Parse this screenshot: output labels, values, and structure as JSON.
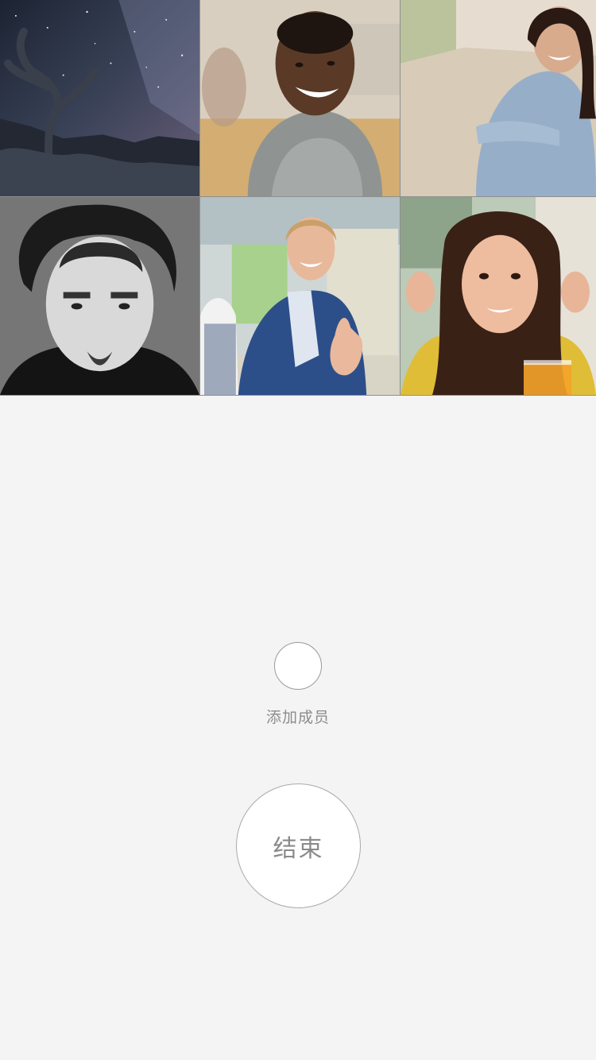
{
  "participants": [
    {
      "label": "starry-sky-tree"
    },
    {
      "label": "smiling-man-gray-shirt"
    },
    {
      "label": "smiling-woman-blue-sweater"
    },
    {
      "label": "bw-portrait-man"
    },
    {
      "label": "man-thumbs-up-blue-blazer"
    },
    {
      "label": "woman-long-hair-yellow"
    }
  ],
  "controls": {
    "add_member_label": "添加成员",
    "end_label": "结束"
  },
  "colors": {
    "background": "#f4f4f4",
    "button_fill": "#ffffff",
    "button_border": "#a9a9a9",
    "text": "#8a8a8a"
  }
}
